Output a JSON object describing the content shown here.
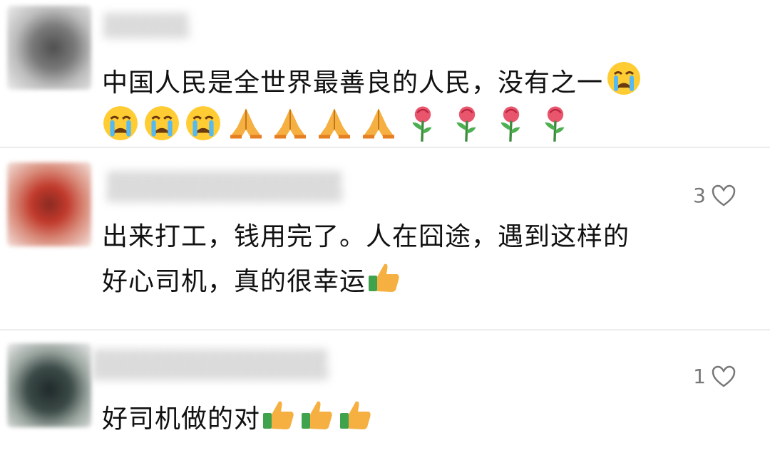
{
  "colors": {
    "text": "#111111",
    "muted": "#777777",
    "divider": "#ececec",
    "background": "#ffffff"
  },
  "comments": [
    {
      "avatar_icon": "avatar",
      "text_lines": [
        "中国人民是全世界最善良的人民，没有之一"
      ],
      "emoji_line": [
        "crying-face-icon",
        "crying-face-icon",
        "crying-face-icon",
        "folded-hands-icon",
        "folded-hands-icon",
        "folded-hands-icon",
        "folded-hands-icon",
        "rose-icon",
        "rose-icon",
        "rose-icon",
        "rose-icon"
      ],
      "likes": ""
    },
    {
      "avatar_icon": "avatar",
      "text_lines": [
        "出来打工，钱用完了。人在囧途，遇到这样的",
        "好心司机，真的很幸运"
      ],
      "likes": "3"
    },
    {
      "avatar_icon": "avatar",
      "text_lines": [
        "好司机做的对"
      ],
      "likes": "1"
    }
  ]
}
